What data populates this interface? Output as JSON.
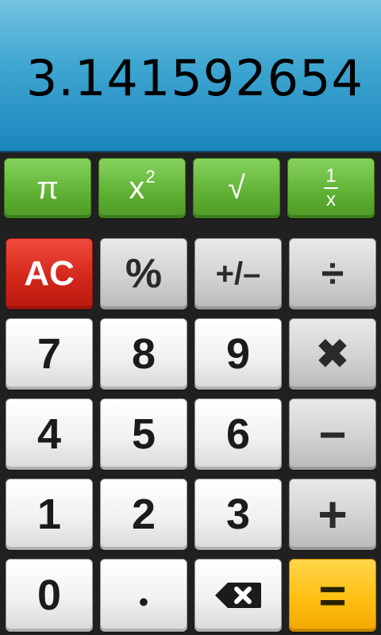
{
  "display": {
    "value": "3.141592654"
  },
  "function_keys": {
    "pi": "π",
    "square_base": "x",
    "square_exp": "2",
    "sqrt": "√",
    "reciprocal_num": "1",
    "reciprocal_den": "x"
  },
  "keys": {
    "clear": "AC",
    "percent": "%",
    "sign": "+/–",
    "divide": "÷",
    "seven": "7",
    "eight": "8",
    "nine": "9",
    "multiply": "✖",
    "four": "4",
    "five": "5",
    "six": "6",
    "minus": "−",
    "one": "1",
    "two": "2",
    "three": "3",
    "plus": "+",
    "zero": "0",
    "decimal": "•",
    "equals": "="
  },
  "icons": {
    "backspace": "backspace-icon"
  },
  "colors": {
    "function_green": "#5fb033",
    "clear_red": "#d12519",
    "equals_orange": "#ffbf12",
    "display_blue": "#3da5d0"
  }
}
